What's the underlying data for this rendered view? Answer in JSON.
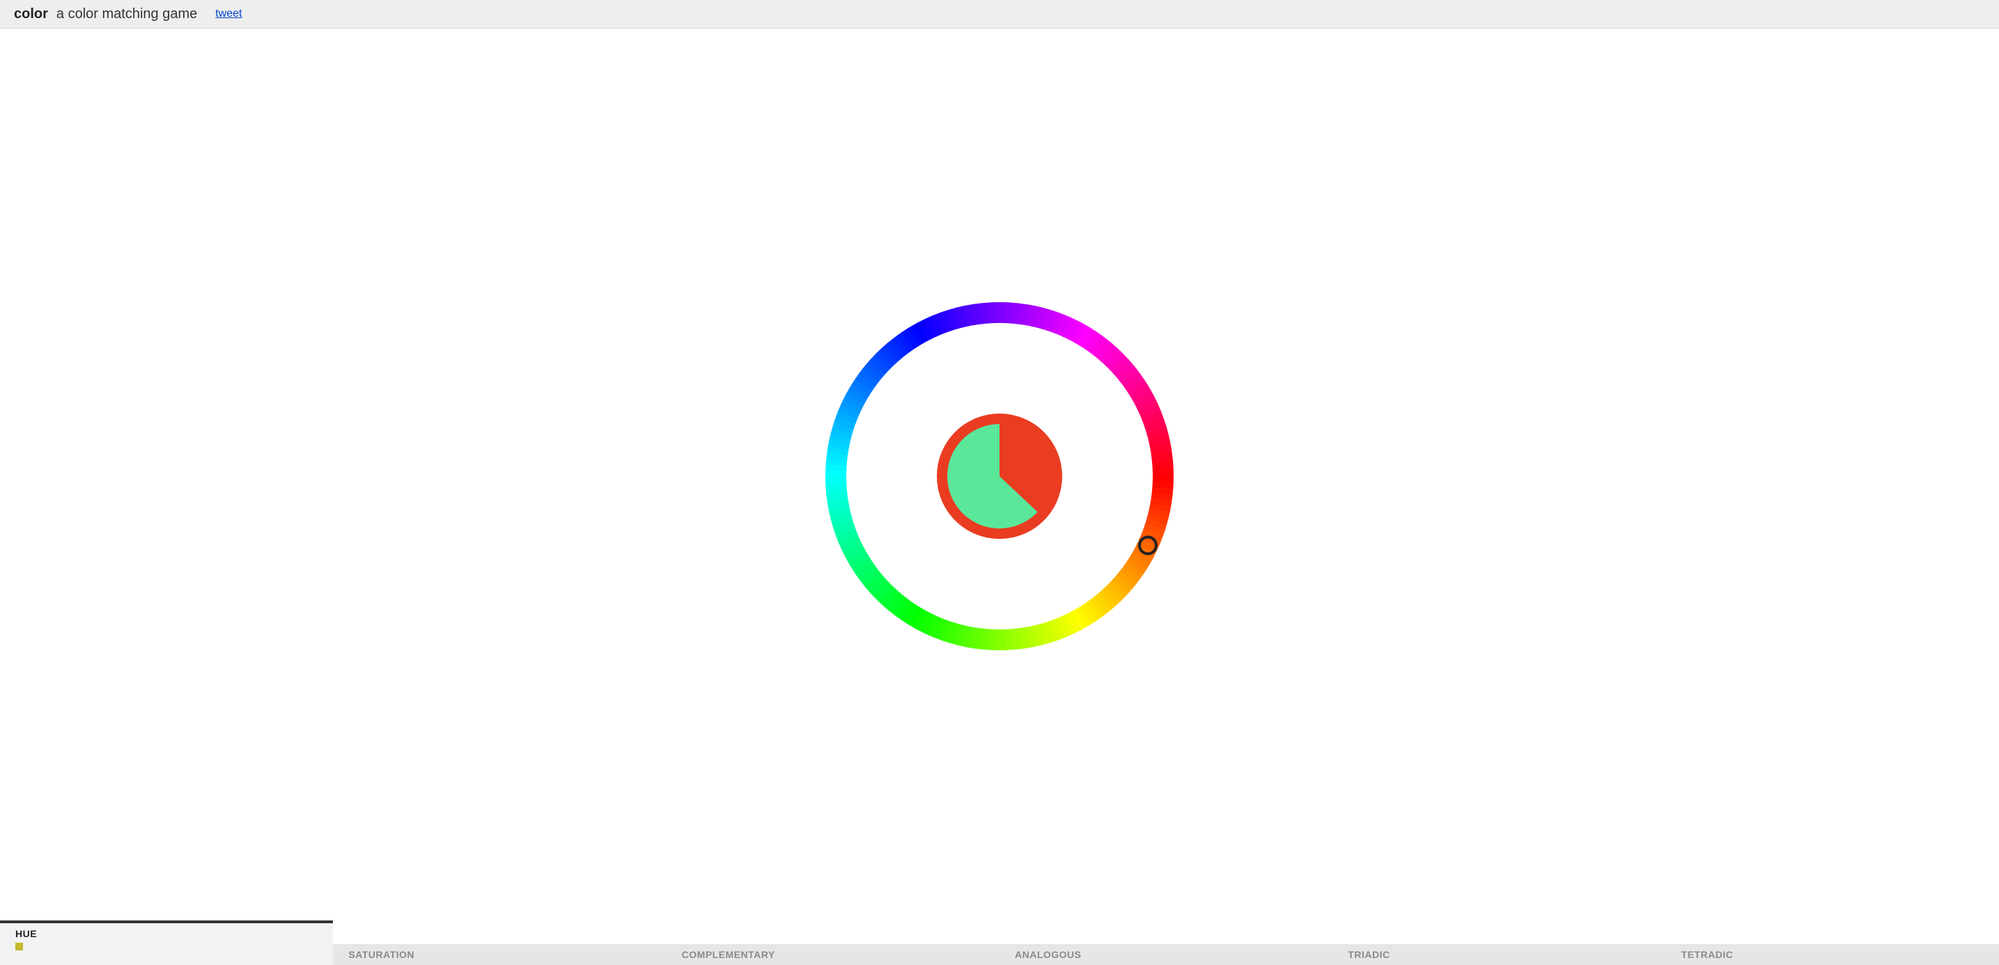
{
  "header": {
    "title_bold": "color",
    "title_rest": "a color matching game",
    "tweet_label": "tweet"
  },
  "game": {
    "target_color": "#EA3C21",
    "picker_angle_deg": 25,
    "timer_fraction_remaining": 0.63,
    "timer_fill_color": "#5AE79A"
  },
  "tabs": {
    "items": [
      {
        "label": "HUE",
        "active": true,
        "swatch": "#C4B82F"
      },
      {
        "label": "SATURATION",
        "active": false
      },
      {
        "label": "COMPLEMENTARY",
        "active": false
      },
      {
        "label": "ANALOGOUS",
        "active": false
      },
      {
        "label": "TRIADIC",
        "active": false
      },
      {
        "label": "TETRADIC",
        "active": false
      }
    ]
  }
}
